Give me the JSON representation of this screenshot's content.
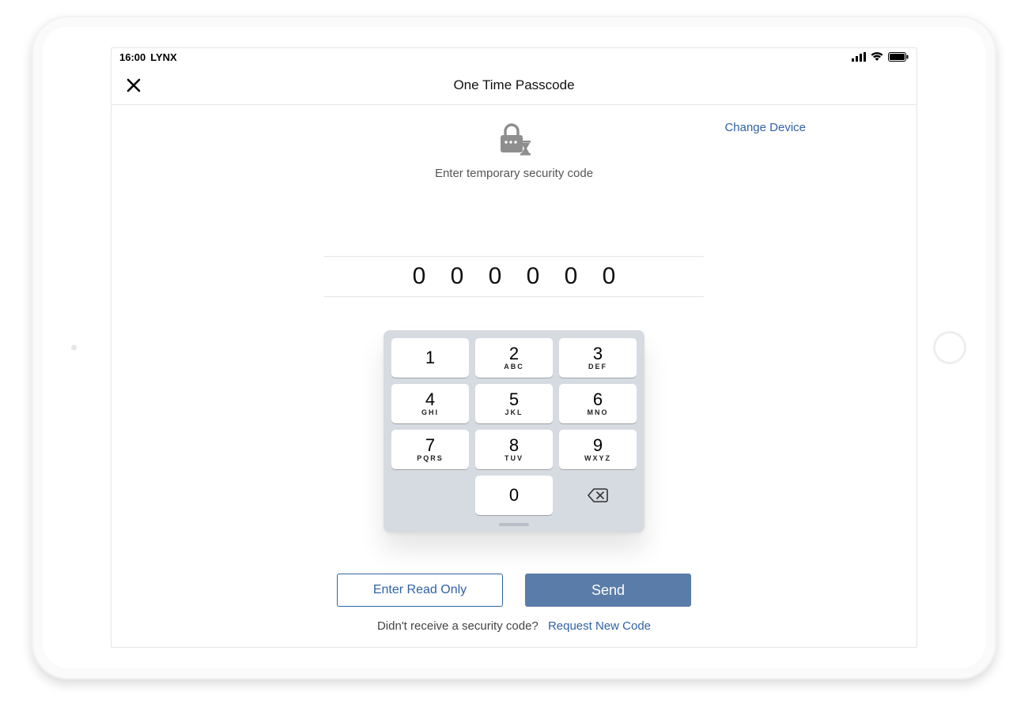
{
  "statusbar": {
    "time": "16:00",
    "carrier": "LYNX"
  },
  "navbar": {
    "title": "One Time Passcode"
  },
  "actions": {
    "change_device": "Change Device"
  },
  "prompt": {
    "subtitle": "Enter temporary security code"
  },
  "code": {
    "digits": [
      "0",
      "0",
      "0",
      "0",
      "0",
      "0"
    ]
  },
  "keypad": {
    "keys": [
      {
        "num": "1",
        "sub": ""
      },
      {
        "num": "2",
        "sub": "ABC"
      },
      {
        "num": "3",
        "sub": "DEF"
      },
      {
        "num": "4",
        "sub": "GHI"
      },
      {
        "num": "5",
        "sub": "JKL"
      },
      {
        "num": "6",
        "sub": "MNO"
      },
      {
        "num": "7",
        "sub": "PQRS"
      },
      {
        "num": "8",
        "sub": "TUV"
      },
      {
        "num": "9",
        "sub": "WXYZ"
      },
      {
        "num": "0",
        "sub": ""
      }
    ]
  },
  "buttons": {
    "read_only": "Enter Read Only",
    "send": "Send"
  },
  "help": {
    "question": "Didn't receive a security code?",
    "link": "Request New Code"
  }
}
